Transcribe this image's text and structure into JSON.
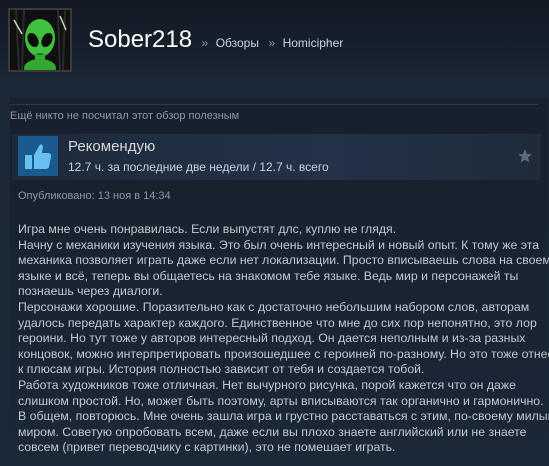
{
  "profile": {
    "persona_name": "Sober218",
    "breadcrumb_separator": "»",
    "breadcrumbs": [
      "Обзоры",
      "Homicipher"
    ]
  },
  "review": {
    "helpful_text": "Ещё никто не посчитал этот обзор полезным",
    "vote_title": "Рекомендую",
    "hours_text": "12.7 ч. за последние две недели / 12.7 ч. всего",
    "posted_label": "Опубликовано:",
    "posted_date": "13 ноя в 14:34",
    "body_lines": [
      "Игра мне очень понравилась. Если выпустят длс, куплю не глядя.",
      "Начну с механики изучения языка. Это был очень интересный и новый опыт. К тому же эта",
      "механика позволяет играть даже если нет локализации. Просто вписываешь слова на своем",
      "языке и всё, теперь вы общаетесь на знакомом тебе языке. Ведь мир и персонажей ты",
      "познаешь через диалоги.",
      "Персонажи хорошие. Поразительно как с достаточно небольшим набором слов, авторам",
      "удалось передать характер каждого. Единственное что мне до сих пор непонятно, это лор",
      "героини. Но тут тоже у авторов интересный подход. Он дается неполным и из-за разных",
      "концовок, можно интерпретировать произошедшее с героиней по-разному. Но это тоже отнесу",
      "к плюсам игры. История полностью зависит от тебя и создается тобой.",
      "Работа художников тоже отличная. Нет вычурного рисунка, порой кажется что он даже",
      "слишком простой. Но, может быть поэтому, арты вписываются так органично и гармонично.",
      "В общем, повторюсь. Мне очень зашла игра и грустно расставаться с этим, по-своему милым,",
      "миром. Советую опробовать всем, даже если вы плохо знаете английский или не знаете",
      "совсем (привет переводчику с картинки), это не помешает играть."
    ]
  },
  "icons": {
    "avatar": "alien-avatar",
    "vote": "thumbs-up-icon",
    "award": "star-icon"
  },
  "colors": {
    "background": "#1b2838",
    "persona_name": "#ffffff",
    "thumb_box": "#1a5a8e",
    "body_text": "#c2c9cf"
  }
}
